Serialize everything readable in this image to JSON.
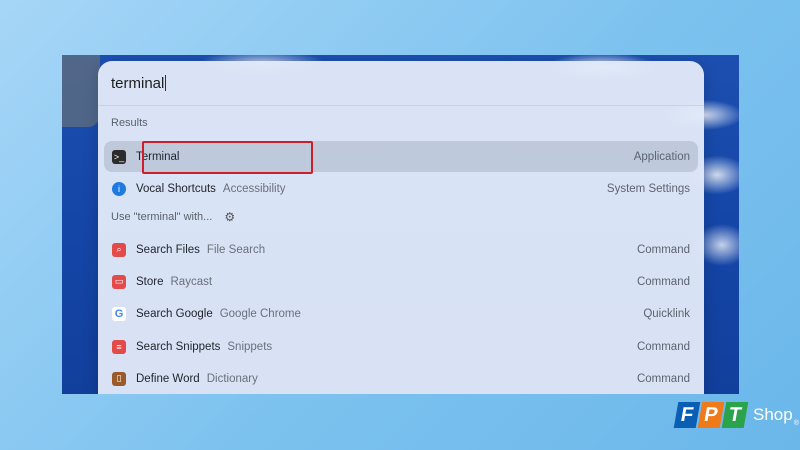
{
  "search": {
    "value": "terminal"
  },
  "sections": {
    "results_label": "Results",
    "use_label": "Use \"terminal\" with..."
  },
  "results": [
    {
      "title": "Terminal",
      "subtitle": "",
      "kind": "Application",
      "icon": "terminal-app-icon",
      "icon_color": "#2b2b2b",
      "selected": true
    },
    {
      "title": "Vocal Shortcuts",
      "subtitle": "Accessibility",
      "kind": "System Settings",
      "icon": "accessibility-icon",
      "icon_color": "#1f7ae0",
      "selected": false
    }
  ],
  "use_with": [
    {
      "title": "Search Files",
      "subtitle": "File Search",
      "kind": "Command",
      "icon": "search-files-icon",
      "icon_color": "#e34b4b"
    },
    {
      "title": "Store",
      "subtitle": "Raycast",
      "kind": "Command",
      "icon": "store-icon",
      "icon_color": "#e34b4b"
    },
    {
      "title": "Search Google",
      "subtitle": "Google Chrome",
      "kind": "Quicklink",
      "icon": "google-icon",
      "icon_color": "#ffffff"
    },
    {
      "title": "Search Snippets",
      "subtitle": "Snippets",
      "kind": "Command",
      "icon": "snippets-icon",
      "icon_color": "#e34b4b"
    },
    {
      "title": "Define Word",
      "subtitle": "Dictionary",
      "kind": "Command",
      "icon": "dictionary-icon",
      "icon_color": "#9a5a2a"
    }
  ],
  "logo": {
    "letters": [
      "F",
      "P",
      "T"
    ],
    "shop": "Shop",
    "reg": "®"
  },
  "colors": {
    "highlight": "#cc1f2a",
    "accent": "#1f7ae0"
  }
}
